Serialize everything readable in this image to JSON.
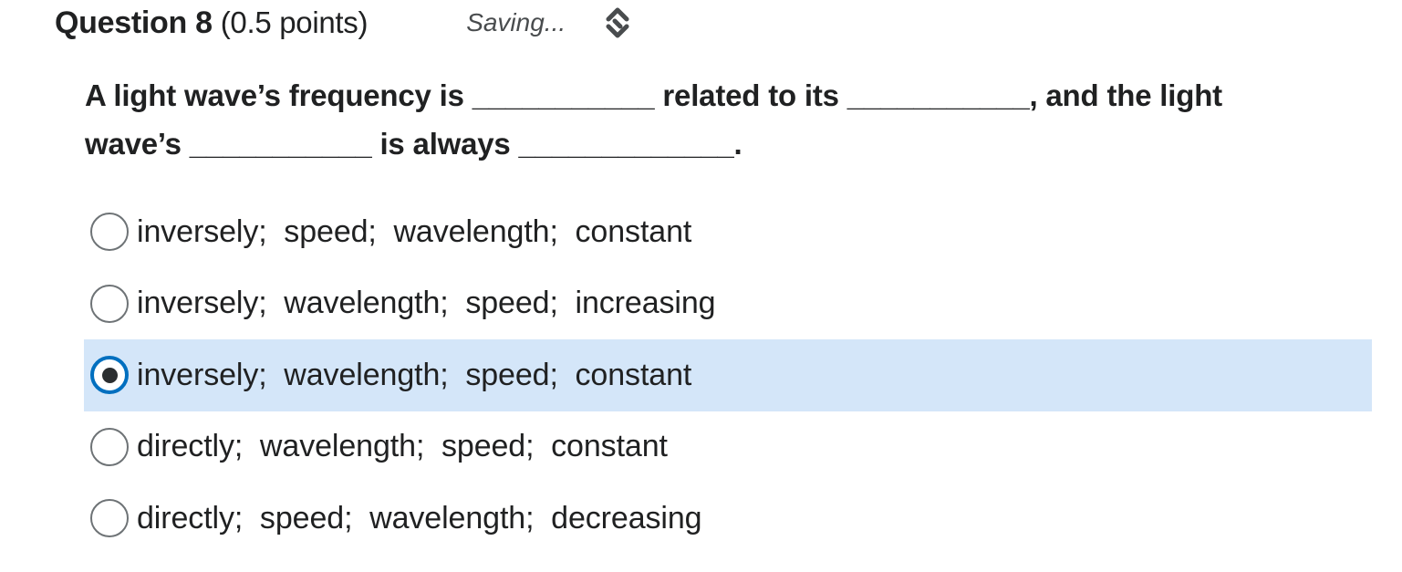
{
  "question": {
    "title": "Question 8",
    "points": "(0.5 points)",
    "status": "Saving...",
    "status_icon": "sync-icon",
    "text_line1": "A light wave’s frequency is ___________ related to its ___________,  and the light",
    "text_line2": "wave’s ___________ is always _____________."
  },
  "options": [
    {
      "label": "inversely;  speed;  wavelength;  constant",
      "selected": false
    },
    {
      "label": "inversely;  wavelength;  speed;  increasing",
      "selected": false
    },
    {
      "label": "inversely;  wavelength;  speed;  constant",
      "selected": true
    },
    {
      "label": "directly;  wavelength;  speed;  constant",
      "selected": false
    },
    {
      "label": "directly;  speed;  wavelength;  decreasing",
      "selected": false
    }
  ],
  "colors": {
    "selected_background": "#d4e6f9",
    "radio_checked_border": "#006fbf",
    "radio_border": "#6e7376",
    "text": "#202122"
  }
}
